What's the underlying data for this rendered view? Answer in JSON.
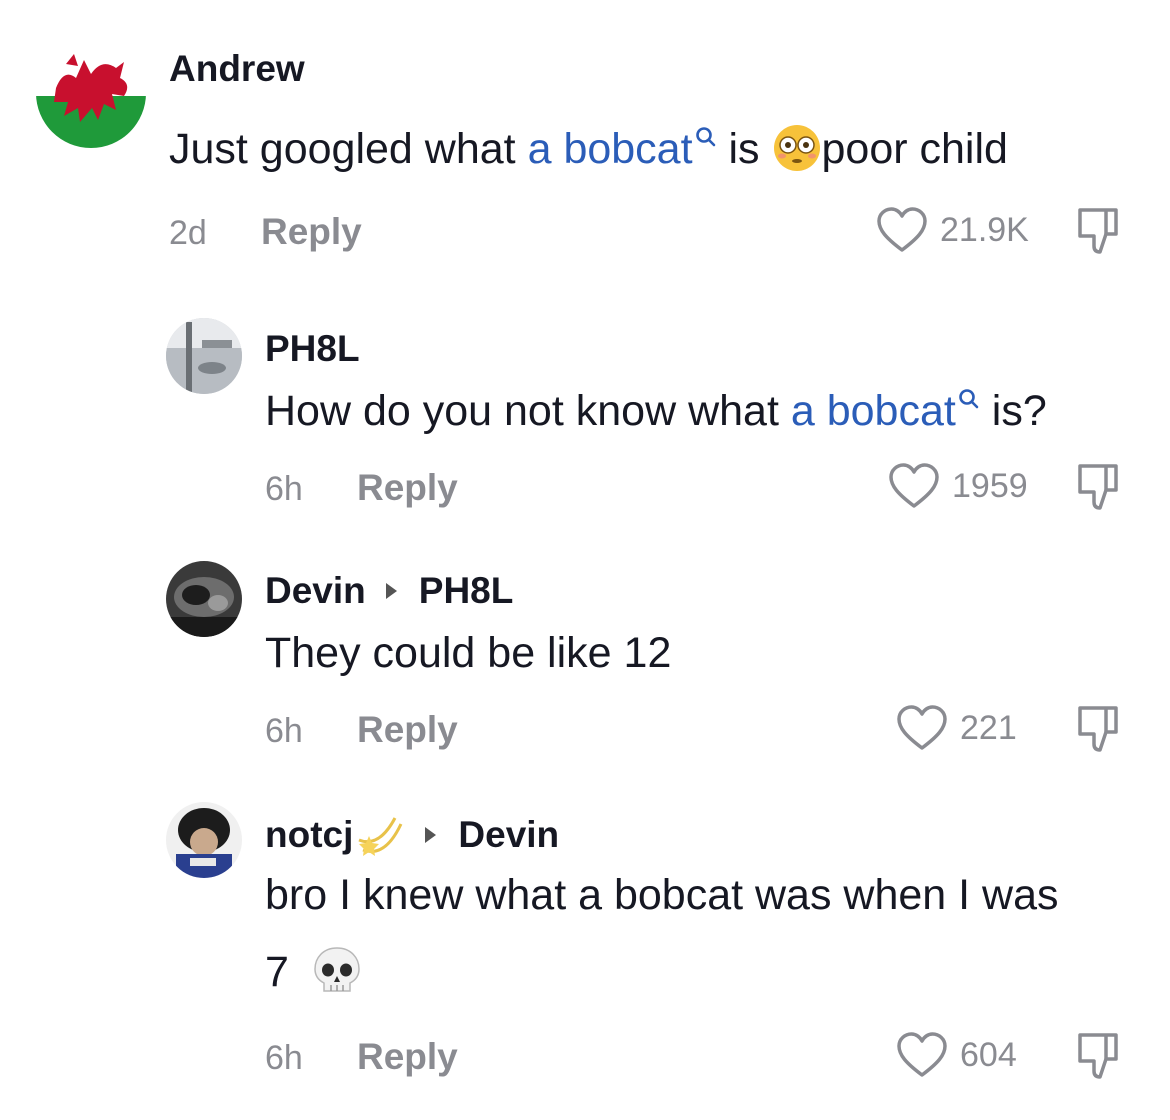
{
  "comments": [
    {
      "username": "Andrew",
      "text_before": "Just googled what ",
      "link": "a bobcat",
      "text_after_link": " is ",
      "emoji": "flushed-face",
      "text_after_emoji": "poor child",
      "time": "2d",
      "reply_label": "Reply",
      "likes": "21.9K"
    },
    {
      "username": "PH8L",
      "text_before": "How do you not know what ",
      "link": "a bobcat",
      "text_after_link": " is?",
      "time": "6h",
      "reply_label": "Reply",
      "likes": "1959"
    },
    {
      "username": "Devin",
      "reply_to": "PH8L",
      "text": "They could be like 12",
      "time": "6h",
      "reply_label": "Reply",
      "likes": "221"
    },
    {
      "username": "notcj",
      "username_emoji": "shooting-star",
      "reply_to": "Devin",
      "text_line1": "bro I knew what a bobcat was when I was",
      "text_line2": "7",
      "emoji": "skull",
      "time": "6h",
      "reply_label": "Reply",
      "likes": "604"
    }
  ],
  "colors": {
    "text": "#161823",
    "muted": "#8a8b91",
    "link": "#2b5db8"
  }
}
